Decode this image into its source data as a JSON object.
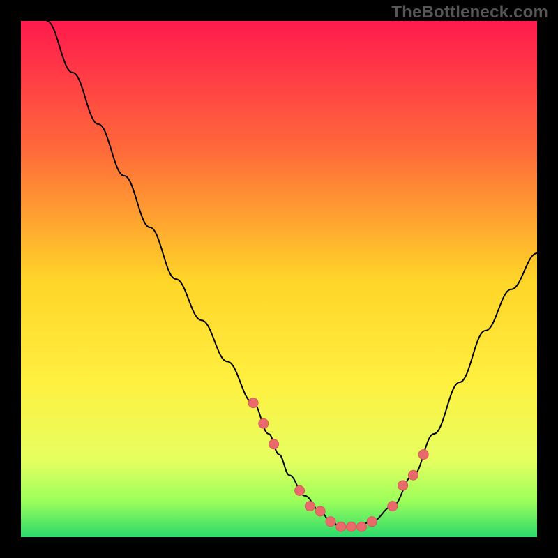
{
  "watermark": "TheBottleneck.com",
  "colors": {
    "background": "#000000",
    "curve_stroke": "#000000",
    "marker_fill": "#e86a6a",
    "marker_stroke": "#d85a5a",
    "gradient_stops": [
      {
        "offset": 0.0,
        "color": "#ff1a4d"
      },
      {
        "offset": 0.25,
        "color": "#ff6a3a"
      },
      {
        "offset": 0.5,
        "color": "#ffd428"
      },
      {
        "offset": 0.7,
        "color": "#fff040"
      },
      {
        "offset": 0.85,
        "color": "#e6ff60"
      },
      {
        "offset": 0.93,
        "color": "#9cff5a"
      },
      {
        "offset": 1.0,
        "color": "#2bd96b"
      }
    ]
  },
  "chart_data": {
    "type": "line",
    "title": "",
    "xlabel": "",
    "ylabel": "",
    "xrange": [
      0,
      100
    ],
    "yrange": [
      0,
      100
    ],
    "curve": {
      "x": [
        5,
        10,
        15,
        20,
        25,
        30,
        35,
        40,
        45,
        48,
        50,
        52,
        55,
        58,
        60,
        62,
        65,
        68,
        72,
        76,
        80,
        85,
        90,
        95,
        100
      ],
      "y": [
        100,
        90,
        80,
        70,
        60,
        50,
        42,
        34,
        26,
        20,
        16,
        12,
        8,
        5,
        3,
        2,
        2,
        3,
        6,
        12,
        20,
        30,
        40,
        48,
        55
      ]
    },
    "markers": {
      "x": [
        45,
        47,
        49,
        54,
        56,
        58,
        60,
        62,
        64,
        66,
        68,
        72,
        74,
        76,
        78
      ],
      "y": [
        26,
        22,
        18,
        9,
        6,
        5,
        3,
        2,
        2,
        2,
        3,
        6,
        10,
        12,
        16
      ]
    }
  }
}
